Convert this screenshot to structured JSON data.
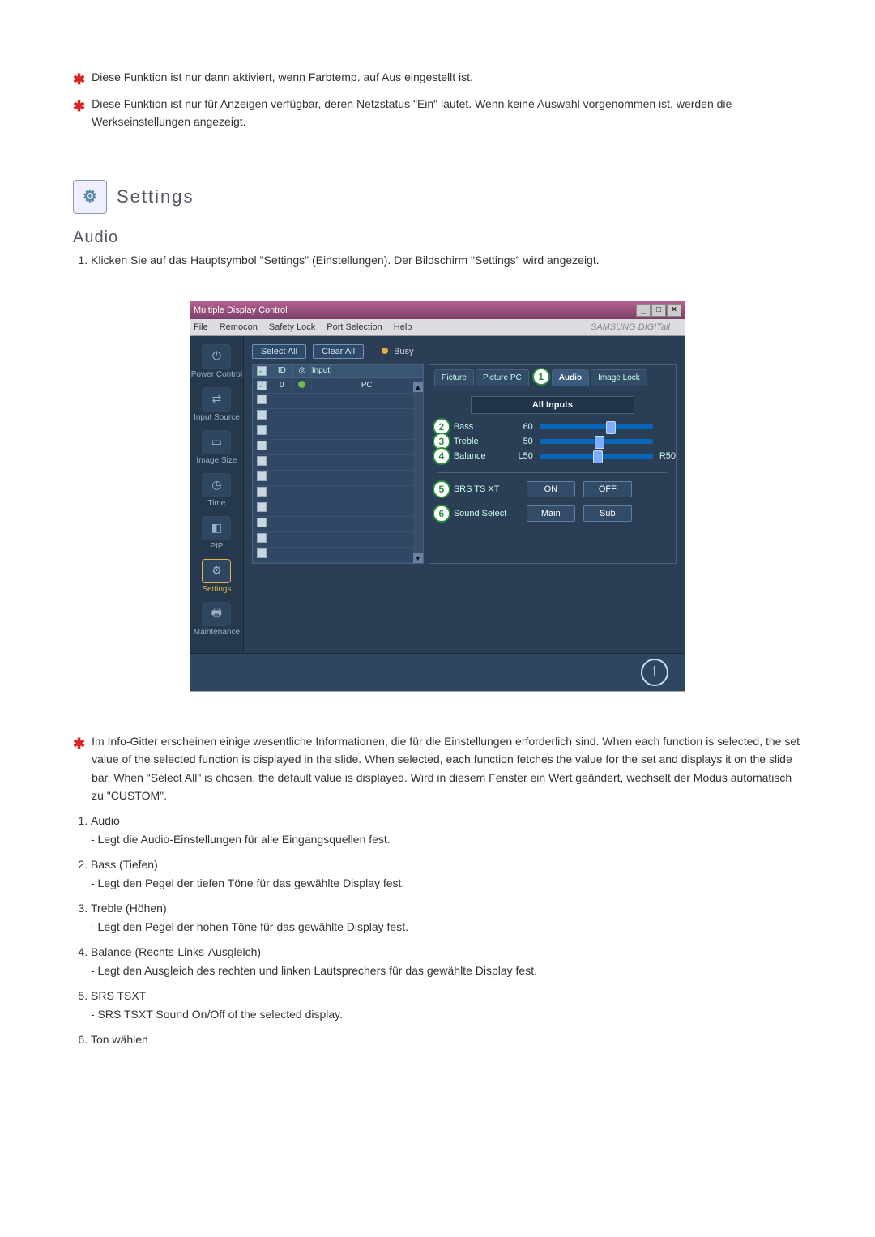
{
  "notes": {
    "n1": "Diese Funktion ist nur dann aktiviert, wenn Farbtemp. auf Aus eingestellt ist.",
    "n2": "Diese Funktion ist nur für Anzeigen verfügbar, deren Netzstatus \"Ein\" lautet. Wenn keine Auswahl vorgenommen ist, werden die Werkseinstellungen angezeigt."
  },
  "section_title": "Settings",
  "subsection": "Audio",
  "steps": {
    "s1": "Klicken Sie auf das Hauptsymbol \"Settings\" (Einstellungen). Der Bildschirm \"Settings\" wird angezeigt."
  },
  "screenshot": {
    "title": "Multiple Display Control",
    "menus": [
      "File",
      "Remocon",
      "Safety Lock",
      "Port Selection",
      "Help"
    ],
    "brand": "SAMSUNG DIGITall",
    "select_all": "Select All",
    "clear_all": "Clear All",
    "busy": "Busy",
    "grid_head": {
      "id": "ID",
      "input": "Input"
    },
    "grid_row1": {
      "id": "0",
      "input": "PC"
    },
    "sidebar": {
      "power": "Power Control",
      "input": "Input Source",
      "image": "Image Size",
      "time": "Time",
      "pip": "PIP",
      "settings": "Settings",
      "maint": "Maintenance"
    },
    "tabs": {
      "picture": "Picture",
      "ppc": "Picture PC",
      "audio": "Audio",
      "imlock": "Image Lock"
    },
    "all_inputs": "All Inputs",
    "audio": {
      "bass_label": "Bass",
      "bass_val": "60",
      "treble_label": "Treble",
      "treble_val": "50",
      "balance_label": "Balance",
      "balance_l": "L50",
      "balance_r": "R50",
      "srs_label": "SRS TS XT",
      "on": "ON",
      "off": "OFF",
      "ss_label": "Sound Select",
      "main": "Main",
      "sub": "Sub"
    },
    "callouts": {
      "c1": "1",
      "c2": "2",
      "c3": "3",
      "c4": "4",
      "c5": "5",
      "c6": "6"
    }
  },
  "desc_note": "Im Info-Gitter erscheinen einige wesentliche Informationen, die für die Einstellungen erforderlich sind. When each function is selected, the set value of the selected function is displayed in the slide. When selected, each function fetches the value for the set and displays it on the slide bar. When \"Select All\" is chosen, the default value is displayed. Wird in diesem Fenster ein Wert geändert, wechselt der Modus automatisch zu \"CUSTOM\".",
  "explain": {
    "i1t": "Audio",
    "i1s": "- Legt die Audio-Einstellungen für alle Eingangsquellen fest.",
    "i2t": "Bass (Tiefen)",
    "i2s": "- Legt den Pegel der tiefen Töne für das gewählte Display fest.",
    "i3t": "Treble (Höhen)",
    "i3s": "- Legt den Pegel der hohen Töne für das gewählte Display fest.",
    "i4t": "Balance (Rechts-Links-Ausgleich)",
    "i4s": "- Legt den Ausgleich des rechten und linken Lautsprechers für das gewählte Display fest.",
    "i5t": "SRS TSXT",
    "i5s": "- SRS TSXT Sound On/Off of the selected display.",
    "i6t": "Ton wählen"
  }
}
